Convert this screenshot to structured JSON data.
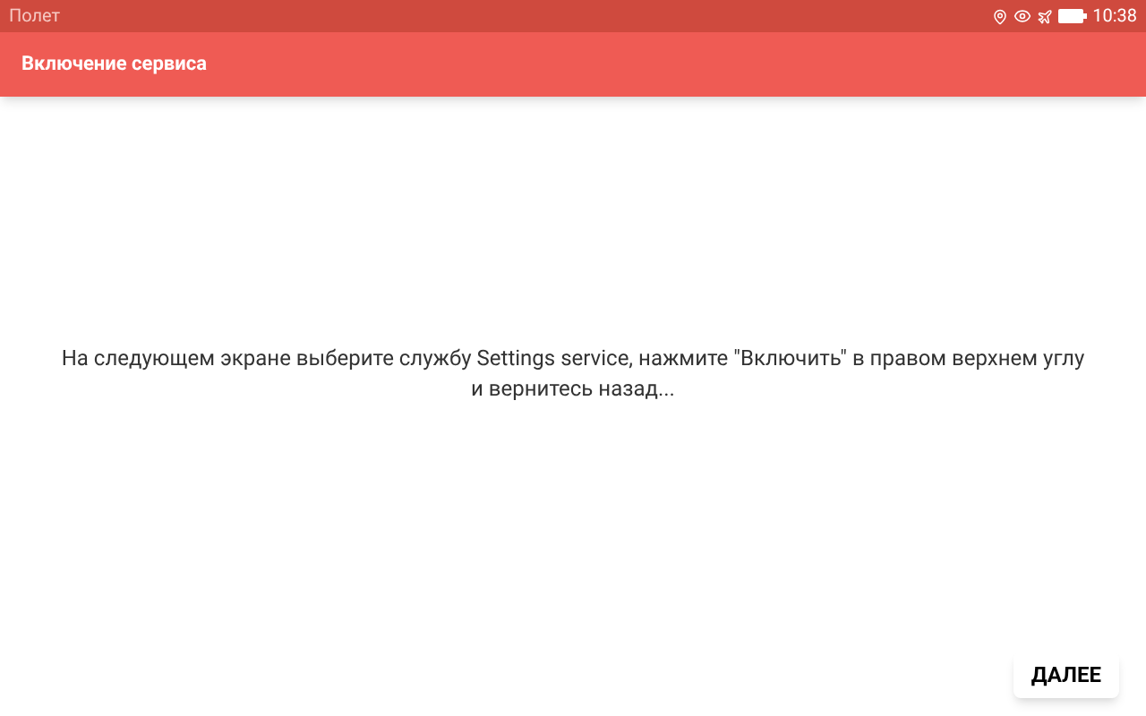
{
  "status_bar": {
    "carrier": "Полет",
    "time": "10:38"
  },
  "toolbar": {
    "title": "Включение сервиса"
  },
  "message": "На следующем экране выберите службу Settings service, нажмите \"Включить\" в правом верхнем углу и вернитесь назад...",
  "buttons": [
    "ДАЛЕЕ"
  ]
}
